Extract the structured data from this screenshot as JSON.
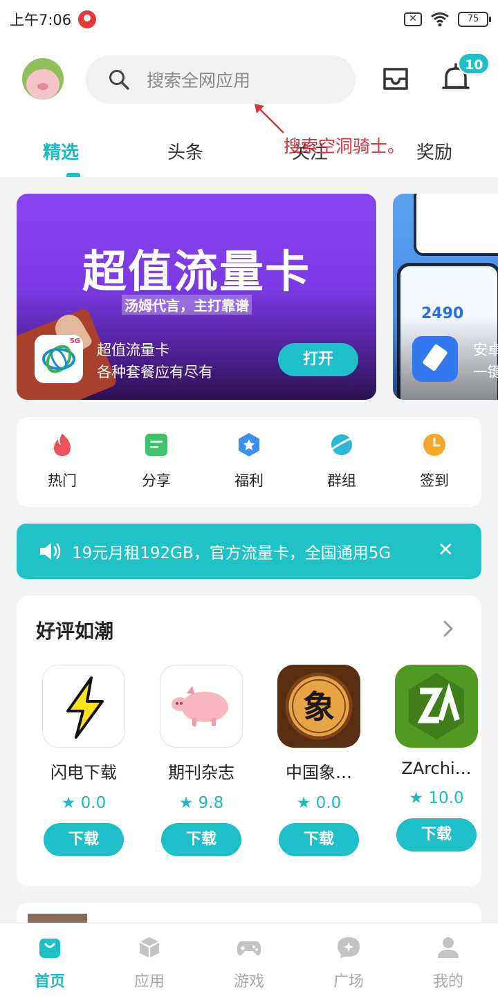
{
  "status_bar": {
    "time": "上午7:06",
    "battery": "75"
  },
  "header": {
    "search_placeholder": "搜索全网应用",
    "notification_count": "10",
    "tabs": [
      {
        "label": "精选"
      },
      {
        "label": "头条"
      },
      {
        "label": "关注"
      },
      {
        "label": "奖励"
      }
    ],
    "annotation": "搜索空洞骑士。"
  },
  "banner": {
    "title": "超值流量卡",
    "slogan": "汤姆代言，主打靠谱",
    "app_name": "超值流量卡",
    "app_desc": "各种套餐应有尽有",
    "open_label": "打开",
    "tile_badge": "5G",
    "next_number": "2490",
    "next_name": "安卓",
    "next_desc": "一键"
  },
  "quick_menu": [
    {
      "label": "热门",
      "icon": "fire-icon"
    },
    {
      "label": "分享",
      "icon": "share-icon"
    },
    {
      "label": "福利",
      "icon": "gift-icon"
    },
    {
      "label": "群组",
      "icon": "planet-icon"
    },
    {
      "label": "签到",
      "icon": "clock-icon"
    }
  ],
  "notice": {
    "text": "19元月租192GB，官方流量卡，全国通用5G",
    "close": "✕"
  },
  "reviews": {
    "title": "好评如潮",
    "apps": [
      {
        "name": "闪电下载",
        "score": "★ 0.0",
        "button": "下载"
      },
      {
        "name": "期刊杂志",
        "score": "★ 9.8",
        "button": "下载"
      },
      {
        "name": "中国象…",
        "score": "★ 0.0",
        "button": "下载"
      },
      {
        "name": "ZArchi…",
        "score": "★ 10.0",
        "button": "下载"
      }
    ],
    "chess_char": "象"
  },
  "bottom_nav": [
    {
      "label": "首页",
      "icon": "home-bag-icon"
    },
    {
      "label": "应用",
      "icon": "cube-icon"
    },
    {
      "label": "游戏",
      "icon": "gamepad-icon"
    },
    {
      "label": "广场",
      "icon": "chat-spark-icon"
    },
    {
      "label": "我的",
      "icon": "person-icon"
    }
  ],
  "colors": {
    "accent": "#1dc0c8",
    "annotation": "#e0303c",
    "banner": "#8a44f0"
  }
}
